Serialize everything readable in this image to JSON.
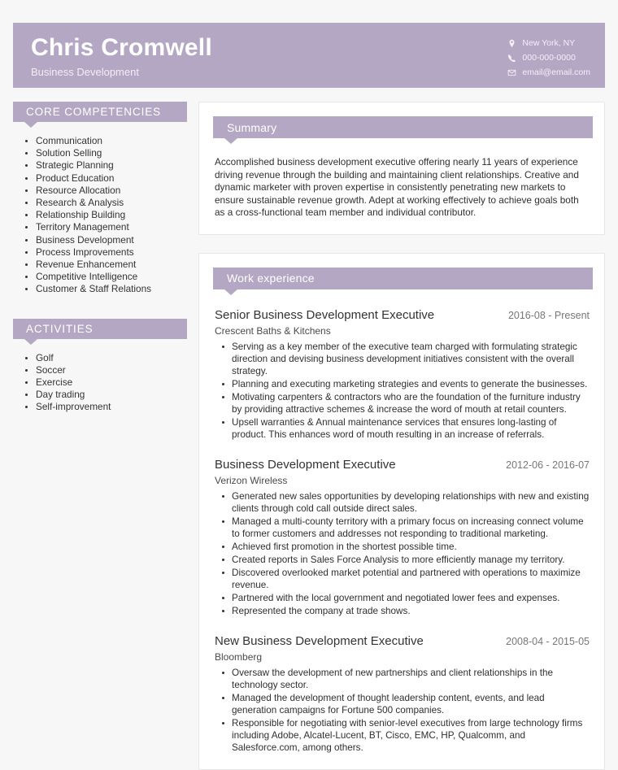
{
  "header": {
    "name": "Chris Cromwell",
    "subtitle": "Business Development",
    "contact": [
      {
        "icon": "location-pin-icon",
        "text": "New York, NY"
      },
      {
        "icon": "phone-icon",
        "text": "000-000-0000"
      },
      {
        "icon": "envelope-icon",
        "text": "email@email.com"
      }
    ]
  },
  "sidebar": {
    "competencies": {
      "title": "CORE COMPETENCIES",
      "items": [
        "Communication",
        "Solution Selling",
        "Strategic Planning",
        "Product Education",
        "Resource Allocation",
        "Research & Analysis",
        "Relationship Building",
        "Territory Management",
        "Business Development",
        "Process Improvements",
        "Revenue Enhancement",
        "Competitive Intelligence",
        "Customer & Staff Relations"
      ]
    },
    "activities": {
      "title": "ACTIVITIES",
      "items": [
        "Golf",
        "Soccer",
        "Exercise",
        "Day trading",
        "Self-improvement"
      ]
    }
  },
  "summary": {
    "title": "Summary",
    "text": "Accomplished business development executive offering nearly 11 years of experience driving revenue through the building and maintaining client relationships. Creative and dynamic marketer with proven expertise in consistently penetrating new markets to ensure sustainable revenue growth. Adept at working effectively to achieve goals both as a cross-functional team member and individual contributor."
  },
  "work": {
    "title": "Work experience",
    "jobs": [
      {
        "title": "Senior Business Development Executive",
        "date": "2016-08 - Present",
        "company": "Crescent Baths & Kitchens",
        "bullets": [
          "Serving as a key member of the executive team charged with formulating strategic direction and devising business development initiatives consistent with the overall strategy.",
          "Planning and executing marketing strategies and events to generate the businesses.",
          "Motivating carpenters & contractors who are the foundation of the furniture industry by providing attractive schemes & increase the word of mouth at retail counters.",
          "Upsell warranties & Annual maintenance services that ensures long-lasting of product. This enhances word of mouth resulting in an increase of referrals."
        ]
      },
      {
        "title": "Business Development Executive",
        "date": "2012-06 - 2016-07",
        "company": "Verizon Wireless",
        "bullets": [
          "Generated new sales opportunities by developing relationships with new and existing clients through cold call outside direct sales.",
          "Managed a multi-county territory with a primary focus on increasing connect volume to former customers and addresses not responding to traditional marketing.",
          "Achieved first promotion in the shortest possible time.",
          "Created reports in Sales Force Analysis to more efficiently manage my territory.",
          "Discovered overlooked market potential and partnered with operations to maximize revenue.",
          "Partnered with the local government and negotiated lower fees and expenses.",
          "Represented the company at trade shows."
        ]
      },
      {
        "title": "New Business Development Executive",
        "date": "2008-04 - 2015-05",
        "company": "Bloomberg",
        "bullets": [
          "Oversaw the development of new partnerships and client relationships in the technology sector.",
          "Managed the development of thought leadership content, events, and lead generation campaigns for Fortune 500 companies.",
          "Responsible for negotiating with senior-level executives from large technology firms including Adobe, Alcatel-Lucent, BT, Cisco, EMC, HP, Qualcomm, and Salesforce.com, among others."
        ]
      }
    ]
  },
  "colors": {
    "accent": "#b4a7c4",
    "page_background": "#f7f7f7",
    "card_background": "#ffffff",
    "text": "#2f2f2f",
    "muted_text": "#777777"
  }
}
